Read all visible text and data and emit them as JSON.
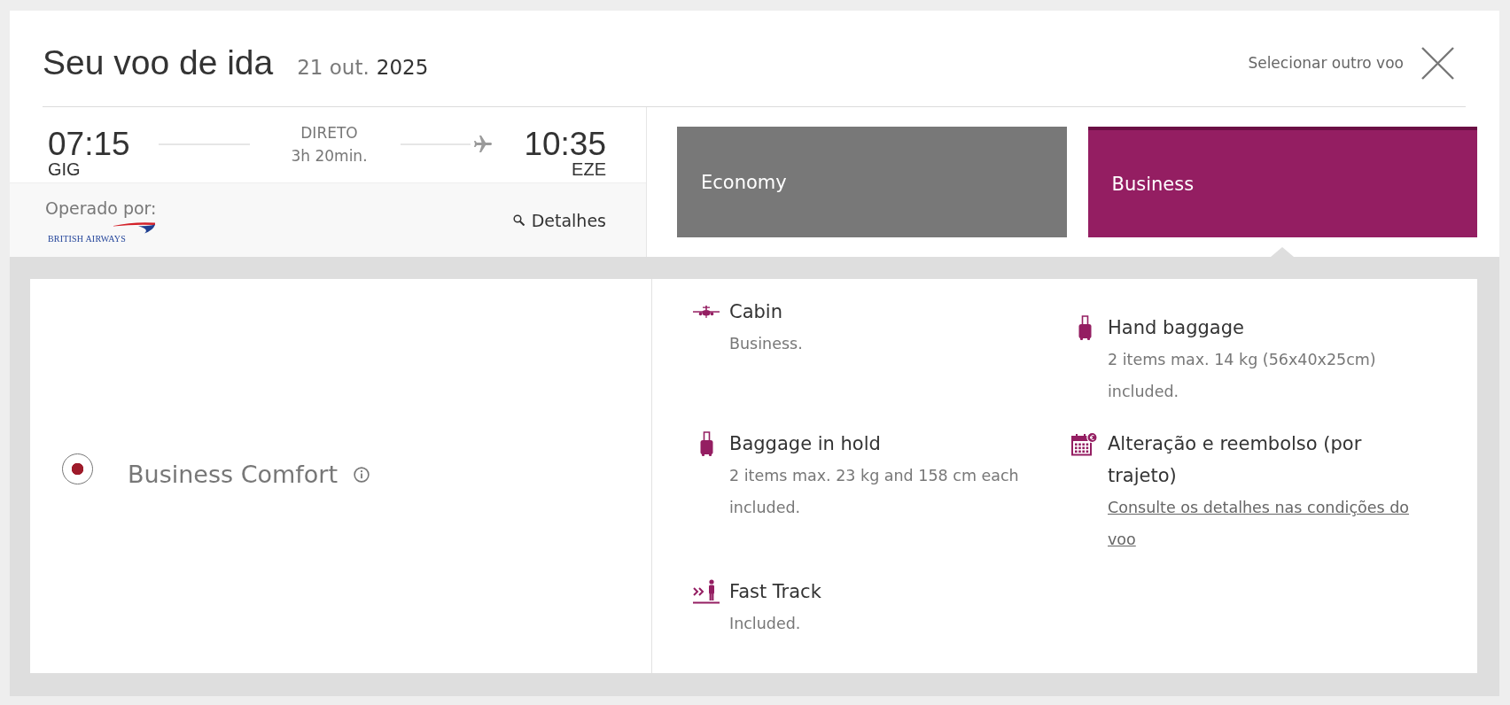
{
  "header": {
    "title": "Seu voo de ida",
    "date": "21 out.",
    "year": "2025",
    "change_flight_link": "Selecionar outro voo"
  },
  "flight": {
    "departure": {
      "time": "07:15",
      "airport": "GIG"
    },
    "stops": "DIRETO",
    "duration": "3h 20min.",
    "arrival": {
      "time": "10:35",
      "airport": "EZE"
    },
    "operated_by_label": "Operado por:",
    "airline_logo_text": "BRITISH AIRWAYS",
    "details_link": "Detalhes"
  },
  "cabin_tabs": [
    {
      "label": "Economy",
      "selected": false
    },
    {
      "label": "Business",
      "selected": true
    }
  ],
  "fare": {
    "name": "Business Comfort",
    "selected": true
  },
  "features": [
    {
      "kind": "cabin",
      "title": "Cabin",
      "text": "Business."
    },
    {
      "kind": "baggage",
      "title": "Hand baggage",
      "text": "2 items max. 14 kg (56x40x25cm) included."
    },
    {
      "kind": "baggage",
      "title": "Baggage in hold",
      "text": "2 items max. 23 kg and 158 cm each included."
    },
    {
      "kind": "refund",
      "title": "Alteração e reembolso (por trajeto)",
      "link": "Consulte os detalhes nas condições do voo"
    },
    {
      "kind": "fasttrack",
      "title": "Fast Track",
      "text": "Included."
    }
  ]
}
